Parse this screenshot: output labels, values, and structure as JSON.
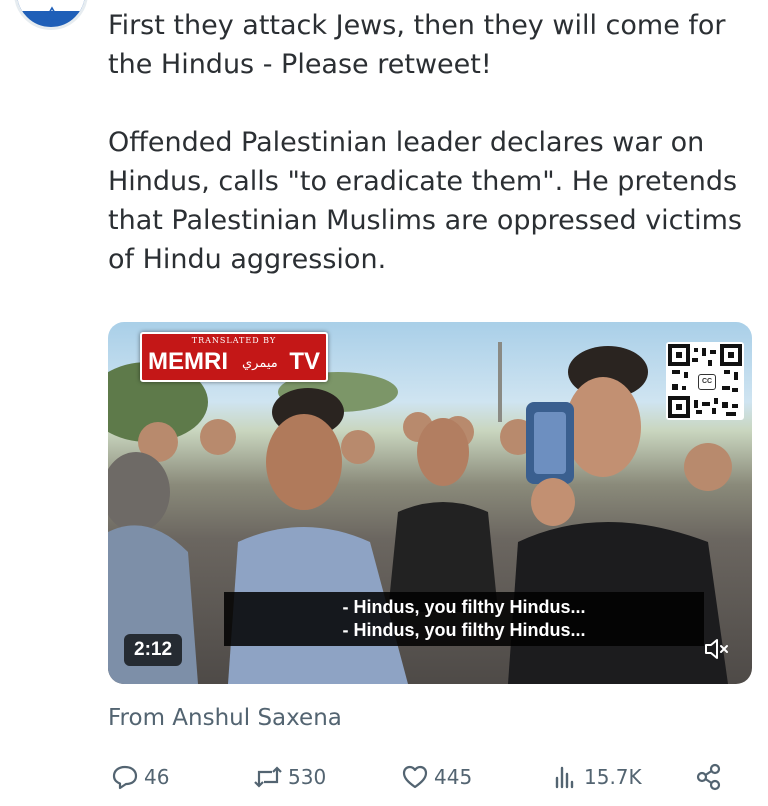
{
  "tweet": {
    "text": "First they attack Jews, then they will come for the Hindus - Please retweet!\n\nOffended Palestinian leader declares war on Hindus, calls \"to eradicate them\". He pretends that Palestinian Muslims are oppressed victims of Hindu aggression.",
    "source": "From Anshul Saxena"
  },
  "media": {
    "logo_top": "TRANSLATED BY",
    "logo_main": "MEMRI",
    "logo_arabic": "ميمري",
    "logo_tv": "TV",
    "qr_badge": "CC",
    "subtitle_lines": [
      "- Hindus, you filthy Hindus...",
      "- Hindus, you filthy Hindus..."
    ],
    "duration": "2:12"
  },
  "actions": {
    "replies": "46",
    "retweets": "530",
    "likes": "445",
    "views": "15.7K"
  },
  "colors": {
    "text": "#2b2f33",
    "muted": "#536471",
    "memri_red": "#c41717",
    "avatar_blue": "#1f5fb8"
  },
  "icons": [
    "star-of-david-icon",
    "reply-icon",
    "retweet-icon",
    "like-icon",
    "views-icon",
    "share-icon",
    "mute-icon",
    "qr-code-icon"
  ]
}
